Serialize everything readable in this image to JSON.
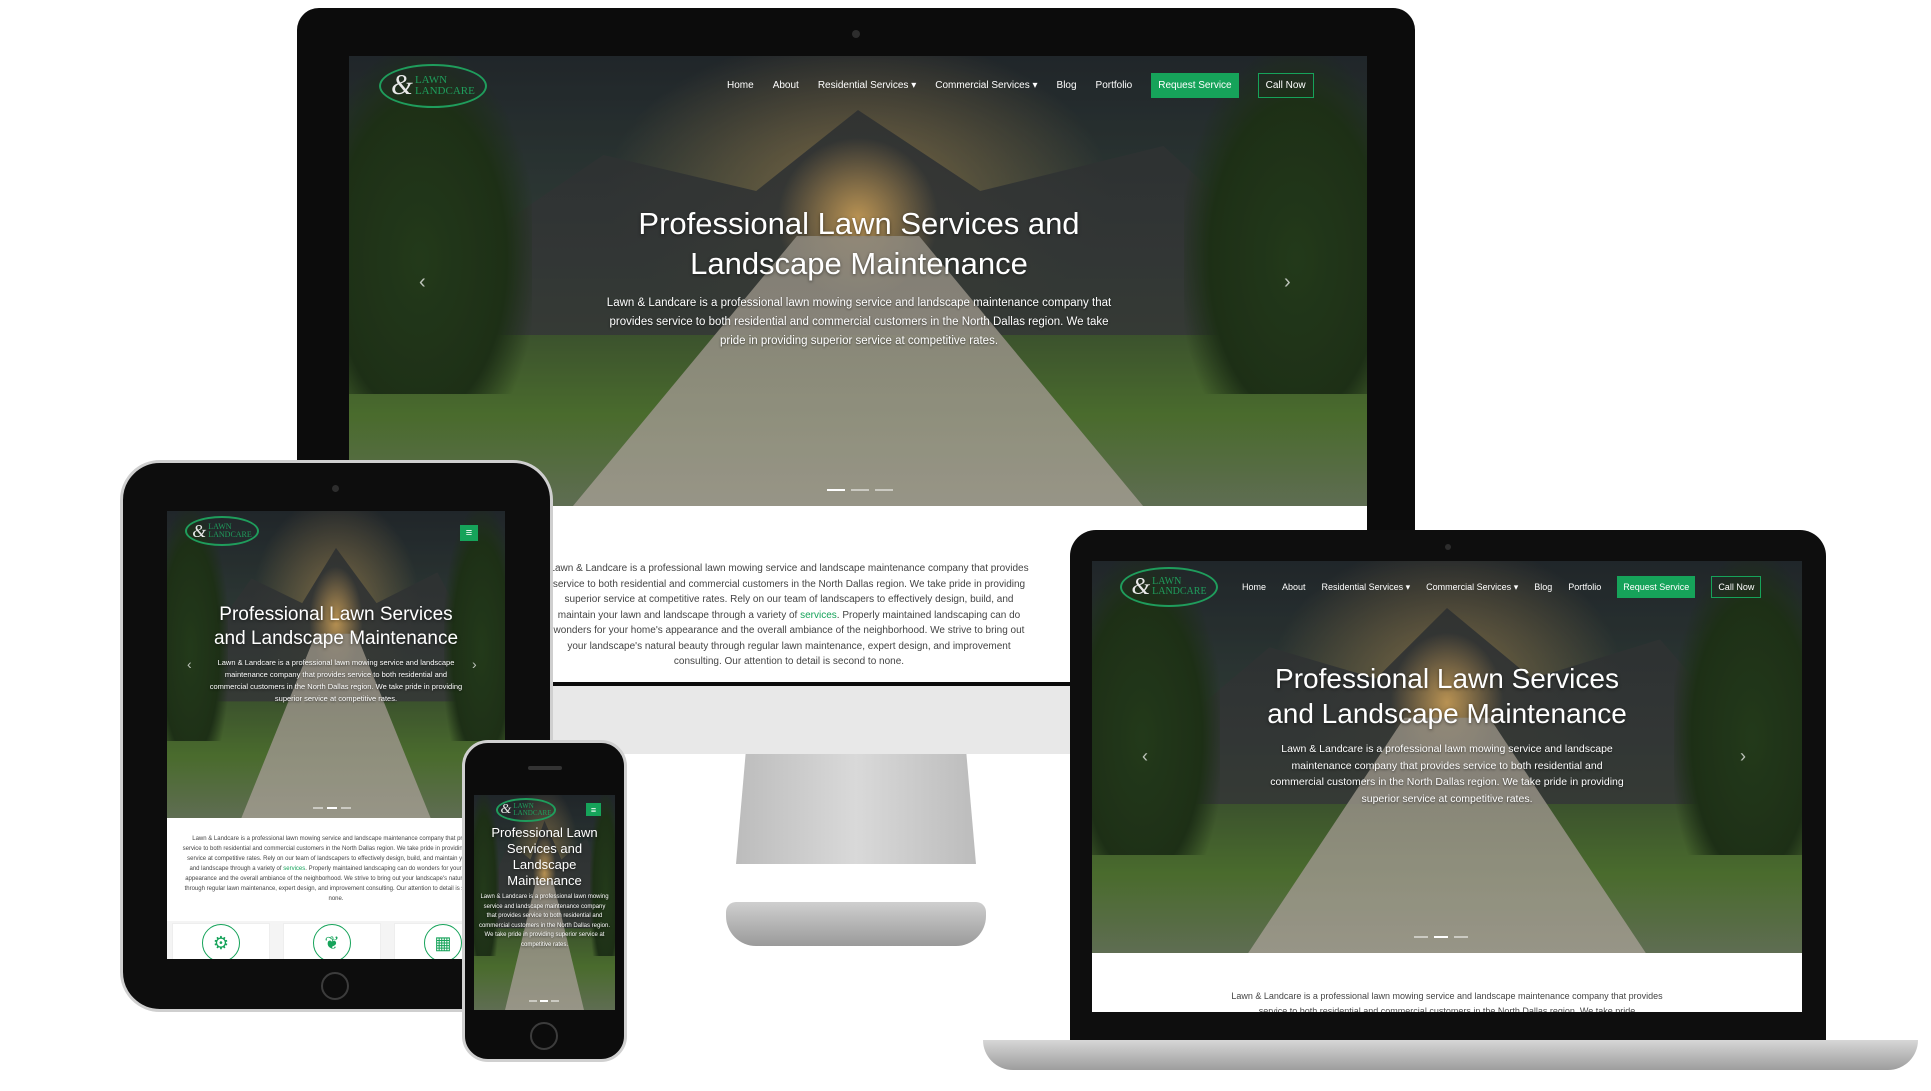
{
  "brand": {
    "line1": "LAWN",
    "ampersand": "&",
    "line2": "LANDCARE",
    "accent_color": "#16a35a"
  },
  "nav": {
    "home": "Home",
    "about": "About",
    "residential": "Residential Services",
    "commercial": "Commercial Services",
    "caret": "▾",
    "blog": "Blog",
    "portfolio": "Portfolio",
    "request": "Request Service",
    "call": "Call Now",
    "menu_icon": "≡"
  },
  "hero": {
    "title": "Professional Lawn Services and Landscape Maintenance",
    "description": "Lawn & Landcare is a professional lawn mowing service and landscape maintenance company that provides service to both residential and commercial customers in the North Dallas region. We take pride in providing superior service at competitive rates.",
    "prev": "‹",
    "next": "›"
  },
  "intro": {
    "text_a": "Lawn & Landcare is a professional lawn mowing service and landscape maintenance company that provides service to both residential and commercial customers in the North Dallas region. We take pride in providing superior service at competitive rates. Rely on our team of landscapers to effectively design, build, and maintain your lawn and landscape through a variety of",
    "link": "services",
    "text_b": ". Properly maintained landscaping can do wonders for your home's appearance and the overall ambiance of the neighborhood. We strive to bring out your landscape's natural beauty through regular lawn maintenance, expert design, and improvement consulting. Our attention to detail is second to none.",
    "laptop_text": "Lawn & Landcare is a professional lawn mowing service and landscape maintenance company that provides service to both residential and commercial customers in the North Dallas region. We take pride"
  },
  "services_icons": [
    "mower-icon",
    "plant-icon",
    "building-icon"
  ]
}
